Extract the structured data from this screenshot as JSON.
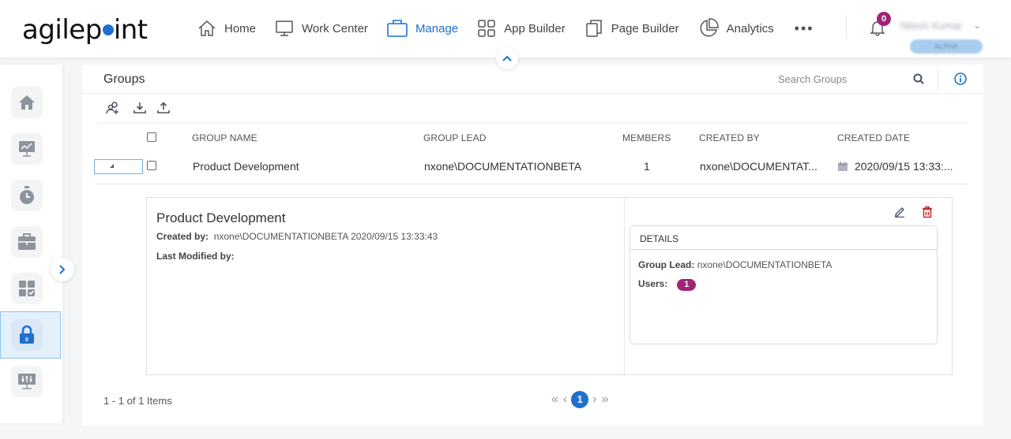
{
  "header": {
    "logo": {
      "prefix": "agilep",
      "suffix": "int"
    },
    "nav": [
      {
        "label": "Home",
        "icon": "home-icon"
      },
      {
        "label": "Work Center",
        "icon": "monitor-icon"
      },
      {
        "label": "Manage",
        "icon": "briefcase-icon",
        "active": true
      },
      {
        "label": "App Builder",
        "icon": "grid-icon"
      },
      {
        "label": "Page Builder",
        "icon": "pages-icon"
      },
      {
        "label": "Analytics",
        "icon": "pie-chart-icon"
      }
    ],
    "more_label": "•••",
    "notifications_count": "0",
    "user_name": "Nilesh Kumar",
    "user_role": "ALPHA"
  },
  "sidebar": {
    "items": [
      {
        "name": "home",
        "icon": "home-icon"
      },
      {
        "name": "analytics",
        "icon": "presentation-chart-icon"
      },
      {
        "name": "timer",
        "icon": "stopwatch-icon"
      },
      {
        "name": "work",
        "icon": "briefcase-icon"
      },
      {
        "name": "apps",
        "icon": "apps-check-icon"
      },
      {
        "name": "security",
        "icon": "lock-icon",
        "active": true
      },
      {
        "name": "system",
        "icon": "sliders-monitor-icon"
      }
    ]
  },
  "page": {
    "title": "Groups",
    "search_placeholder": "Search Groups"
  },
  "table": {
    "columns": [
      "GROUP NAME",
      "GROUP LEAD",
      "MEMBERS",
      "CREATED BY",
      "CREATED DATE"
    ],
    "rows": [
      {
        "group_name": "Product Development",
        "group_lead": "nxone\\DOCUMENTATIONBETA",
        "members": "1",
        "created_by": "nxone\\DOCUMENTAT...",
        "created_date": "2020/09/15 13:33:..."
      }
    ]
  },
  "detail": {
    "title": "Product Development",
    "created_by_label": "Created by:",
    "created_by_value": "nxone\\DOCUMENTATIONBETA 2020/09/15 13:33:43",
    "last_modified_label": "Last Modified by:",
    "last_modified_value": "",
    "card_title": "DETAILS",
    "group_lead_label": "Group Lead:",
    "group_lead_value": "nxone\\DOCUMENTATIONBETA",
    "users_label": "Users:",
    "users_count": "1"
  },
  "pager": {
    "info": "1 - 1 of 1 Items",
    "first": "«",
    "prev": "‹",
    "current": "1",
    "next": "›",
    "last": "»"
  },
  "colors": {
    "accent": "#1e6fd1",
    "badge": "#a0237a",
    "delete": "#c62828",
    "selected_bg": "#e4f0fc"
  }
}
